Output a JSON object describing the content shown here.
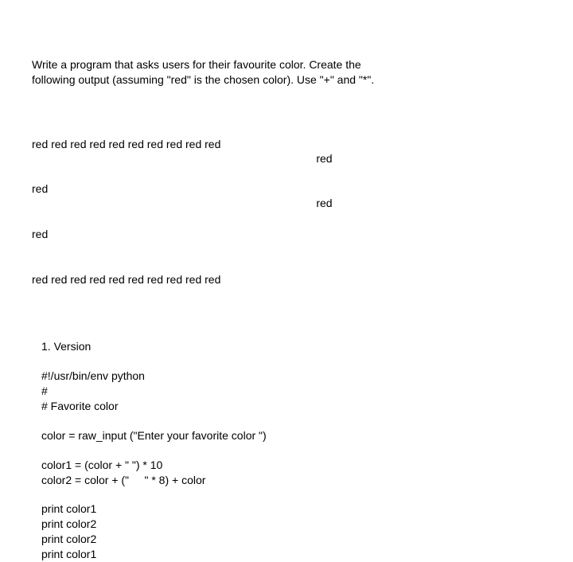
{
  "description": {
    "line1": "Write a program that asks users for their favourite color. Create the",
    "line2": "following output (assuming \"red\" is the chosen color). Use \"+\" and \"*\"."
  },
  "output": {
    "left": {
      "l1": "red red red red red red red red red red",
      "l2": "red",
      "l3": "red",
      "l4": "red red red red red red red red red red"
    },
    "right": {
      "l1": "red",
      "l2": "red"
    }
  },
  "code": {
    "version": "1. Version",
    "shebang": "#!/usr/bin/env python",
    "comment1": "#",
    "comment2": "# Favorite color",
    "input": "color = raw_input (\"Enter your favorite color \")",
    "assign1": "color1 = (color + \" \") * 10",
    "assign2": "color2 = color + (\"     \" * 8) + color",
    "print1": "print color1",
    "print2": "print color2",
    "print3": "print color2",
    "print4": "print color1"
  }
}
